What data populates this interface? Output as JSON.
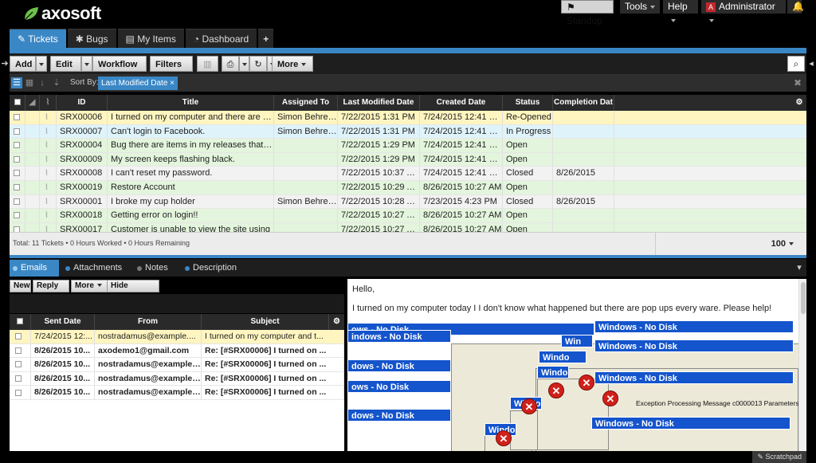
{
  "brand": {
    "name": "axosoft"
  },
  "topnav": {
    "standup": "Standup",
    "tools": "Tools",
    "help": "Help",
    "admin_initial": "A",
    "admin": "Administrator"
  },
  "tabs": [
    {
      "label": "Tickets",
      "icon": "ticket-icon"
    },
    {
      "label": "Bugs",
      "icon": "bug-icon"
    },
    {
      "label": "My Items",
      "icon": "list-icon"
    },
    {
      "label": "Dashboard",
      "icon": "dashboard-icon"
    },
    {
      "label": "+"
    }
  ],
  "toolbar": {
    "add": "Add",
    "edit": "Edit",
    "workflow": "Workflow",
    "filters": "Filters",
    "more": "More"
  },
  "sort": {
    "label": "Sort By:",
    "value": "Last Modified Date",
    "remove": "×"
  },
  "grid": {
    "columns": [
      "ID",
      "Title",
      "Assigned To",
      "Last Modified Date",
      "Created Date",
      "Status",
      "Completion Dat"
    ],
    "rows": [
      {
        "id": "SRX00006",
        "title": "I turned on my computer and there are po...",
        "assigned": "Simon Behrens",
        "modified": "7/22/2015 1:31 PM",
        "created": "7/24/2015 12:41 PM",
        "status": "Re-Opened",
        "completion": "",
        "color": "#fff5c0"
      },
      {
        "id": "SRX00007",
        "title": "Can't login to Facebook.",
        "assigned": "Simon Behrens",
        "modified": "7/22/2015 1:31 PM",
        "created": "7/24/2015 12:41 PM",
        "status": "In Progress",
        "completion": "",
        "color": "#dff3fb"
      },
      {
        "id": "SRX00004",
        "title": "Bug there are items in my releases that a...",
        "assigned": "",
        "modified": "7/22/2015 1:29 PM",
        "created": "7/24/2015 12:41 PM",
        "status": "Open",
        "completion": "",
        "color": "#e3f5dc"
      },
      {
        "id": "SRX00009",
        "title": "My screen keeps flashing black.",
        "assigned": "",
        "modified": "7/22/2015 1:29 PM",
        "created": "7/24/2015 12:41 PM",
        "status": "Open",
        "completion": "",
        "color": "#e3f5dc"
      },
      {
        "id": "SRX00008",
        "title": "I can't reset my password.",
        "assigned": "",
        "modified": "7/22/2015 10:37 AM",
        "created": "7/24/2015 12:41 PM",
        "status": "Closed",
        "completion": "8/26/2015",
        "color": "#f2f2f2"
      },
      {
        "id": "SRX00019",
        "title": "Restore Account",
        "assigned": "",
        "modified": "7/22/2015 10:29 AM",
        "created": "8/26/2015 10:27 AM",
        "status": "Open",
        "completion": "",
        "color": "#e3f5dc"
      },
      {
        "id": "SRX00001",
        "title": "I broke my cup holder",
        "assigned": "Simon Behrens",
        "modified": "7/22/2015 10:28 AM",
        "created": "7/23/2015 4:23 PM",
        "status": "Closed",
        "completion": "8/26/2015",
        "color": "#f2f2f2"
      },
      {
        "id": "SRX00018",
        "title": "Getting error on login!!",
        "assigned": "",
        "modified": "7/22/2015 10:27 AM",
        "created": "8/26/2015 10:27 AM",
        "status": "Open",
        "completion": "",
        "color": "#e3f5dc"
      },
      {
        "id": "SRX00017",
        "title": "Customer is unable to view the site using",
        "assigned": "",
        "modified": "7/22/2015 10:27 AM",
        "created": "8/26/2015 10:27 AM",
        "status": "Open",
        "completion": "",
        "color": "#e3f5dc"
      }
    ],
    "footer": "Total: 11 Tickets • 0 Hours Worked • 0 Hours Remaining",
    "page_size": "100"
  },
  "detail_tabs": [
    "Emails",
    "Attachments",
    "Notes",
    "Description"
  ],
  "email_toolbar": {
    "new": "New",
    "reply": "Reply",
    "more": "More",
    "hide_preview": "Hide Preview"
  },
  "emails": {
    "columns": [
      "Sent Date",
      "From",
      "Subject"
    ],
    "rows": [
      {
        "date": "7/24/2015 12:...",
        "from": "nostradamus@example....",
        "subject": "I turned on my computer and t...",
        "bold": false
      },
      {
        "date": "8/26/2015 10...",
        "from": "axodemo1@gmail.com",
        "subject": "Re: [#SRX00006] I turned on ...",
        "bold": true
      },
      {
        "date": "8/26/2015 10...",
        "from": "nostradamus@example....",
        "subject": "Re: [#SRX00006] I turned on ...",
        "bold": true
      },
      {
        "date": "8/26/2015 10...",
        "from": "nostradamus@example....",
        "subject": "Re: [#SRX00006] I turned on ...",
        "bold": true
      },
      {
        "date": "8/26/2015 10...",
        "from": "nostradamus@example....",
        "subject": "Re: [#SRX00006] I turned on ...",
        "bold": true
      }
    ]
  },
  "preview": {
    "greeting": "Hello,",
    "body": "I turned on my computer today I I don't know what happened but there are pop ups every ware.  Please help!",
    "window_title": "Windows - No Disk",
    "error_message": "Exception Processing Message c0000013 Parameters"
  },
  "scratchpad": "Scratchpad",
  "colors": {
    "accent": "#3a87c6",
    "error_popup_blue": "#1454cc"
  }
}
